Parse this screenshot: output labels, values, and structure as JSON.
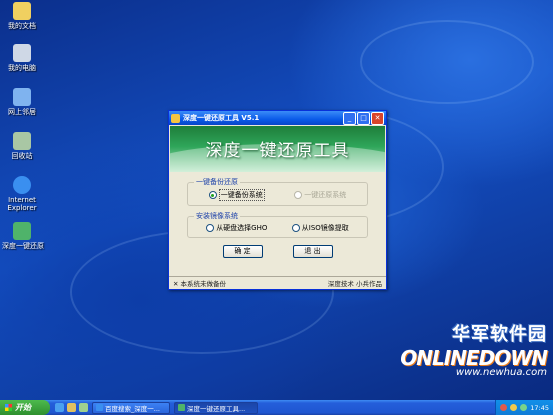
{
  "desktop": {
    "icons": [
      {
        "label": "我的文档",
        "icon": "my-documents-icon",
        "color": "#f0d060"
      },
      {
        "label": "我的电脑",
        "icon": "my-computer-icon",
        "color": "#cfd8e6"
      },
      {
        "label": "网上邻居",
        "icon": "network-places-icon",
        "color": "#7fb3ef"
      },
      {
        "label": "回收站",
        "icon": "recycle-bin-icon",
        "color": "#a9c7a4"
      },
      {
        "label": "Internet Explorer",
        "icon": "internet-explorer-icon",
        "color": "#3a8ff0"
      },
      {
        "label": "深度一键还原",
        "icon": "restore-tool-icon",
        "color": "#4fb36a"
      }
    ]
  },
  "window": {
    "title": "深度一键还原工具  V5.1",
    "banner_title": "深度一键还原工具",
    "backup_group": {
      "legend": "一键备份还原",
      "option_backup": "一键备份系统",
      "option_restore": "一键还原系统"
    },
    "image_group": {
      "legend": "安装镜像系统",
      "option_hdd": "从硬盘选择GHO",
      "option_iso": "从ISO镜像提取"
    },
    "ok_label": "确 定",
    "exit_label": "退 出",
    "status_close_glyph": "✕",
    "status_left": "本系统未做备份",
    "status_right": "深度技术 小兵作品"
  },
  "watermark": {
    "cn": "华军软件园",
    "en": "ONLINEDOWN",
    "url": "www.newhua.com"
  },
  "taskbar": {
    "start_label": "开始",
    "tasks": [
      {
        "label": "百度搜索_深度一...",
        "active": false
      },
      {
        "label": "深度一键还原工具...",
        "active": true
      }
    ],
    "clock": "17:45"
  },
  "colors": {
    "title_bar": "#0a5ae8",
    "banner": "#2fa65a",
    "start_button": "#3aa03a",
    "desktop": "#1450c4"
  }
}
